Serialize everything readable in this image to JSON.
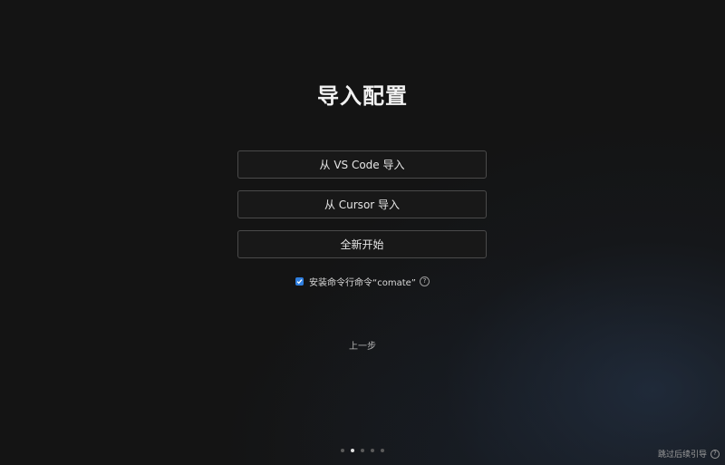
{
  "page": {
    "title": "导入配置"
  },
  "options": {
    "import_vscode_label": "从 VS Code 导入",
    "import_cursor_label": "从 Cursor 导入",
    "start_fresh_label": "全新开始"
  },
  "cli": {
    "install_label": "安装命令行命令“comate”",
    "checked": true,
    "help_icon": "question-circle-icon"
  },
  "nav": {
    "previous_label": "上一步",
    "skip_label": "跳过后续引导",
    "total_steps": 5,
    "current_step": 2
  },
  "colors": {
    "background": "#141414",
    "accent": "#2f7fe0"
  }
}
